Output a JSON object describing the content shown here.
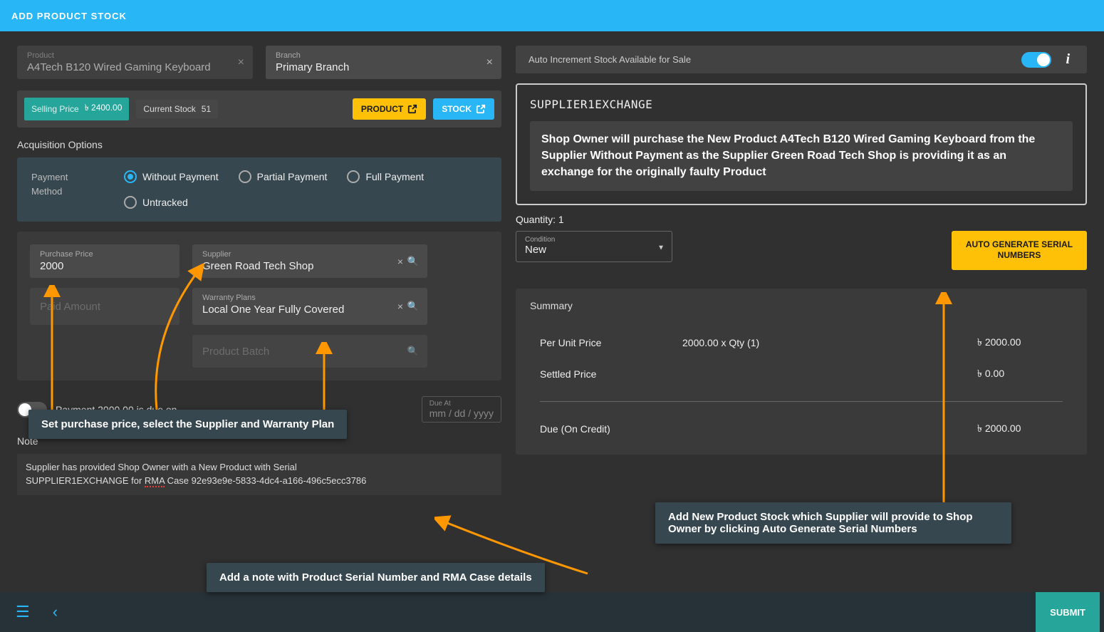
{
  "header": {
    "title": "ADD PRODUCT STOCK"
  },
  "product": {
    "label": "Product",
    "value": "A4Tech B120 Wired Gaming Keyboard"
  },
  "branch": {
    "label": "Branch",
    "value": "Primary Branch"
  },
  "chips": {
    "selling_price_label": "Selling Price",
    "selling_price_value": "৳  2400.00",
    "current_stock_label": "Current Stock",
    "current_stock_value": "51",
    "product_btn": "PRODUCT",
    "stock_btn": "STOCK"
  },
  "acq_label": "Acquisition Options",
  "payment_method": {
    "label": "Payment Method",
    "options": [
      "Without Payment",
      "Partial Payment",
      "Full Payment",
      "Untracked"
    ],
    "selected": "Without Payment"
  },
  "purchase_price": {
    "label": "Purchase Price",
    "value": "2000"
  },
  "supplier": {
    "label": "Supplier",
    "value": "Green Road Tech Shop"
  },
  "paid_amount": {
    "label": "Paid Amount",
    "value": ""
  },
  "warranty": {
    "label": "Warranty Plans",
    "value": "Local One Year Fully Covered"
  },
  "product_batch": {
    "placeholder": "Product Batch"
  },
  "due": {
    "text": "Payment 2000.00 is due on",
    "at_label": "Due At",
    "date_placeholder": "mm / dd / yyyy"
  },
  "note": {
    "label": "Note",
    "text_line1": "Supplier has provided Shop Owner with a New Product with Serial",
    "text_line2a": "SUPPLIER1EXCHANGE for ",
    "text_line2_u": "RMA",
    "text_line2b": " Case 92e93e9e-5833-4dc4-a166-496c5ecc3786"
  },
  "auto_increment": {
    "label": "Auto Increment Stock Available for Sale",
    "on": true
  },
  "serial": {
    "title": "SUPPLIER1EXCHANGE",
    "desc": "Shop Owner will purchase the New Product A4Tech B120 Wired Gaming Keyboard from the Supplier Without Payment as the Supplier Green Road Tech Shop is providing it as an exchange for the originally faulty Product"
  },
  "quantity": {
    "label": "Quantity: 1"
  },
  "condition": {
    "label": "Condition",
    "value": "New"
  },
  "auto_gen_btn": "AUTO GENERATE SERIAL NUMBERS",
  "summary": {
    "title": "Summary",
    "per_unit_label": "Per Unit Price",
    "per_unit_calc": "2000.00 x Qty (1)",
    "per_unit_total": "৳  2000.00",
    "settled_label": "Settled Price",
    "settled_value": "৳  0.00",
    "due_label": "Due (On Credit)",
    "due_value": "৳  2000.00"
  },
  "tooltips": {
    "t1": "Set purchase price, select the Supplier and Warranty Plan",
    "t2": "Add New Product Stock which Supplier will provide to Shop Owner by clicking Auto Generate Serial Numbers",
    "t3": "Add a note with Product Serial Number and RMA Case details"
  },
  "footer": {
    "submit": "SUBMIT"
  }
}
